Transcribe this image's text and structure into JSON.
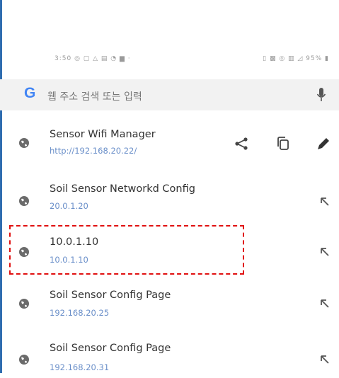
{
  "status_bar": {
    "left": "3:50 ◎ ▢ △ ▤ ◔ ▆ ·",
    "right": "▯ ▩ ◎ ▥ ◿ 95% ▮"
  },
  "search": {
    "logo": "G",
    "placeholder": "웹 주소 검색 또는 입력",
    "icons": [
      "google-logo",
      "mic-icon"
    ]
  },
  "suggestions": [
    {
      "title": "Sensor Wifi Manager",
      "url": "http://192.168.20.22/",
      "actions": [
        "share-icon",
        "copy-icon",
        "edit-icon"
      ]
    },
    {
      "title": "Soil Sensor Networkd Config",
      "url": "20.0.1.20",
      "actions": [
        "insert-arrow-icon"
      ]
    },
    {
      "title": "10.0.1.10",
      "url": "10.0.1.10",
      "actions": [
        "insert-arrow-icon"
      ],
      "highlighted": true
    },
    {
      "title": "Soil Sensor Config Page",
      "url": "192.168.20.25",
      "actions": [
        "insert-arrow-icon"
      ]
    },
    {
      "title": "Soil Sensor Config Page",
      "url": "192.168.20.31",
      "actions": [
        "insert-arrow-icon"
      ]
    }
  ],
  "colors": {
    "accent_link": "#6a8fc9",
    "highlight_border": "#e01010",
    "left_bar": "#2f6db0"
  }
}
